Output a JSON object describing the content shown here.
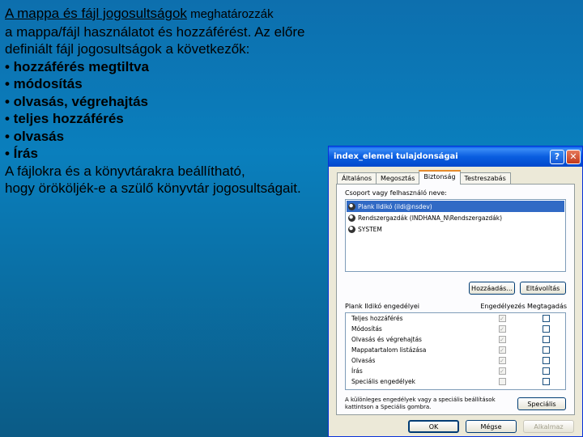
{
  "slide": {
    "title_link": "A mappa és fájl jogosultságok",
    "title_rest": " meghatározzák",
    "lines": [
      "a mappa/fájl használatot és hozzáférést. Az előre",
      "definiált fájl jogosultságok a következők:"
    ],
    "bullets": [
      "• hozzáférés megtiltva",
      "• módosítás",
      "• olvasás, végrehajtás",
      "• teljes hozzáférés",
      "• olvasás",
      "• Írás"
    ],
    "closing": [
      "A fájlokra és a könyvtárakra beállítható,",
      " hogy örököljék-e a szülő könyvtár jogosultságait."
    ]
  },
  "dialog": {
    "title": "index_elemei tulajdonságai",
    "help_symbol": "?",
    "close_symbol": "✕",
    "tabs": [
      "Általános",
      "Megosztás",
      "Biztonság",
      "Testreszabás"
    ],
    "active_tab": "Biztonság",
    "group_label": "Csoport vagy felhasználó neve:",
    "users": [
      "Plank Ildikó (ildi@nsdev)",
      "Rendszergazdák (INDHANA_N\\Rendszergazdák)",
      "SYSTEM"
    ],
    "add_button": "Hozzáadás...",
    "remove_button": "Eltávolítás",
    "perm_label": "Plank Ildikó engedélyei",
    "allow_label": "Engedélyezés",
    "deny_label": "Megtagadás",
    "permissions": [
      "Teljes hozzáférés",
      "Módosítás",
      "Olvasás és végrehajtás",
      "Mappatartalom listázása",
      "Olvasás",
      "Írás",
      "Speciális engedélyek"
    ],
    "check_mark": "✓",
    "hint": "A különleges engedélyek vagy a speciális beállítások kattintson a Speciális gombra.",
    "advanced_button": "Speciális",
    "ok_button": "OK",
    "cancel_button": "Mégse",
    "apply_button": "Alkalmaz"
  }
}
